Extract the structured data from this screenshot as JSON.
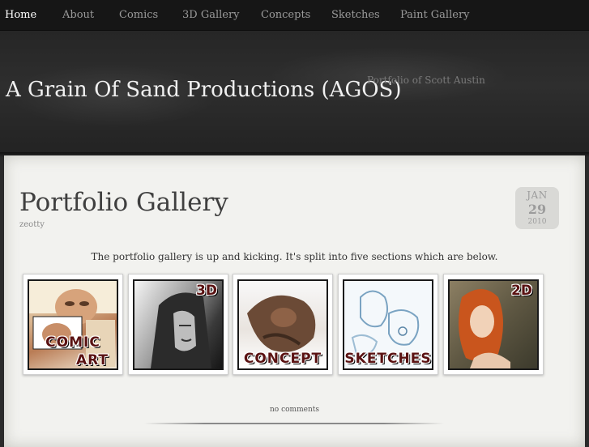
{
  "nav": {
    "items": [
      {
        "label": "Home",
        "active": true
      },
      {
        "label": "About",
        "active": false
      },
      {
        "label": "Comics",
        "active": false
      },
      {
        "label": "3D Gallery",
        "active": false
      },
      {
        "label": "Concepts",
        "active": false
      },
      {
        "label": "Sketches",
        "active": false
      },
      {
        "label": "Paint Gallery",
        "active": false
      }
    ]
  },
  "header": {
    "site_title": "A Grain Of Sand Productions (AGOS)",
    "tagline": "Portfolio of Scott Austin"
  },
  "post": {
    "title": "Portfolio Gallery",
    "author": "zeotty",
    "date": {
      "month": "JAN",
      "day": "29",
      "year": "2010"
    },
    "intro": "The portfolio gallery is up and kicking.  It's split into five sections which are below.",
    "comments_link": "no comments"
  },
  "gallery": [
    {
      "name": "comic-art",
      "label_line1": "COMIC",
      "label_line2": "ART"
    },
    {
      "name": "3d",
      "corner_label": "3D"
    },
    {
      "name": "concept",
      "label_line1": "CONCEPT"
    },
    {
      "name": "sketches",
      "label_line1": "SKETCHES"
    },
    {
      "name": "2d",
      "corner_label": "2D"
    }
  ],
  "colors": {
    "nav_bg": "#161616",
    "header_bg": "#2a2a2a",
    "panel_bg": "#f2f2ef",
    "label_red": "#5a1212"
  }
}
